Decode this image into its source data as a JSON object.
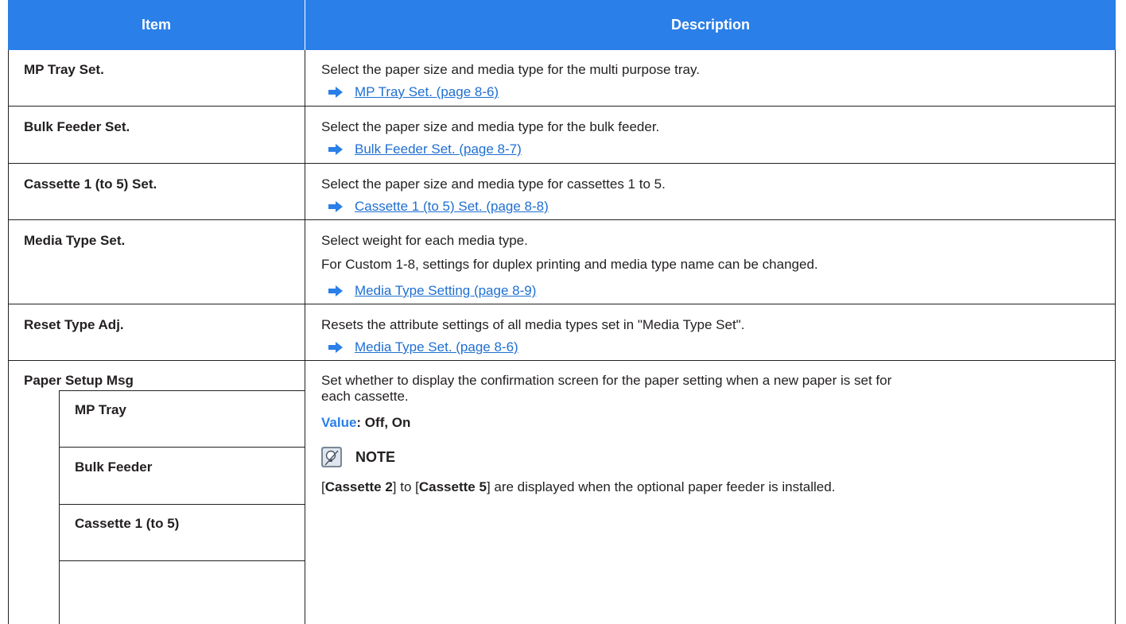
{
  "header": {
    "item": "Item",
    "description": "Description"
  },
  "rows": [
    {
      "item": "MP Tray Set.",
      "desc": "Select the paper size and media type for the multi purpose tray.",
      "link": "MP Tray Set. (page 8-6)"
    },
    {
      "item": "Bulk Feeder Set.",
      "desc": "Select the paper size and media type for the bulk feeder.",
      "link": "Bulk Feeder Set. (page 8-7)"
    },
    {
      "item": "Cassette 1 (to 5) Set.",
      "desc": "Select the paper size and media type for cassettes 1 to 5.",
      "link": "Cassette 1 (to 5) Set. (page 8-8)"
    },
    {
      "item": "Media Type Set.",
      "desc": "Select weight for each media type.",
      "desc2": "For Custom 1-8, settings for duplex printing and media type name can be changed.",
      "link": "Media Type Setting (page 8-9)"
    },
    {
      "item": "Reset Type Adj.",
      "desc": "Resets the attribute settings of all media types set in \"Media Type Set\".",
      "link": "Media Type Set. (page 8-6)"
    }
  ],
  "paper_setup": {
    "item": "Paper Setup Msg",
    "subitems": [
      "MP Tray",
      "Bulk Feeder",
      "Cassette 1 (to 5)"
    ],
    "desc_line1": "Set whether to display the confirmation screen for the paper setting when a new paper is set for",
    "desc_line2": "each cassette.",
    "value_label": "Value",
    "value_text": ": Off, On",
    "note_title": "NOTE",
    "note_bracket_open": "[",
    "note_bold1": "Cassette 2",
    "note_mid": "] to [",
    "note_bold2": "Cassette 5",
    "note_rest": "] are displayed when the optional paper feeder is installed."
  },
  "colors": {
    "header_bg": "#2a7fe8",
    "link": "#1f6fd1",
    "arrow": "#2a7fe8",
    "value_label": "#2a7fe8"
  },
  "icons": {
    "arrow": "arrow-right-icon",
    "note": "lightbulb-note-icon"
  }
}
